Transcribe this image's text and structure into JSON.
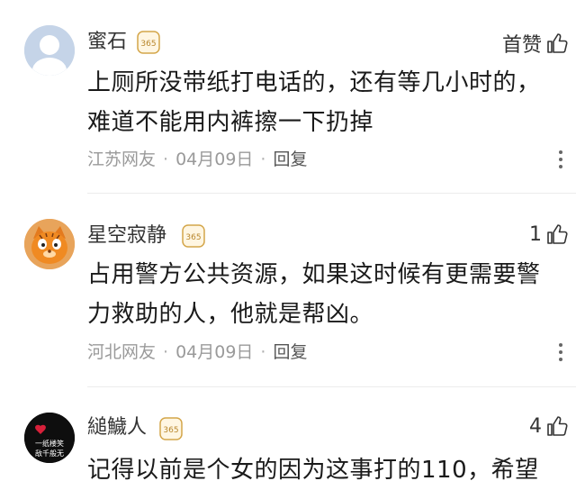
{
  "comments": [
    {
      "username": "蜜石",
      "badge": "365",
      "likes": "首赞",
      "lines": [
        "上厕所没带纸打电话的，还有等几小时的，",
        "难道不能用内裤擦一下扔掉"
      ],
      "location": "江苏网友",
      "date": "04月09日",
      "reply": "回复",
      "avatar": "default-avatar"
    },
    {
      "username": "星空寂静",
      "badge": "365",
      "likes": "1",
      "lines": [
        "占用警方公共资源，如果这时候有更需要警",
        "力救助的人，他就是帮凶。"
      ],
      "location": "河北网友",
      "date": "04月09日",
      "reply": "回复",
      "avatar": "cat-avatar"
    },
    {
      "username": "縋鱥人",
      "badge": "365",
      "likes": "4",
      "lines": [
        "记得以前是个女的因为这事打的110，希望"
      ],
      "avatar_text": [
        "一纸楼笑",
        "敌千般无"
      ],
      "avatar": "dark-avatar"
    }
  ],
  "colors": {
    "badge": "#d4a64a",
    "meta": "#9a9a9a",
    "text": "#1a1a1a"
  }
}
